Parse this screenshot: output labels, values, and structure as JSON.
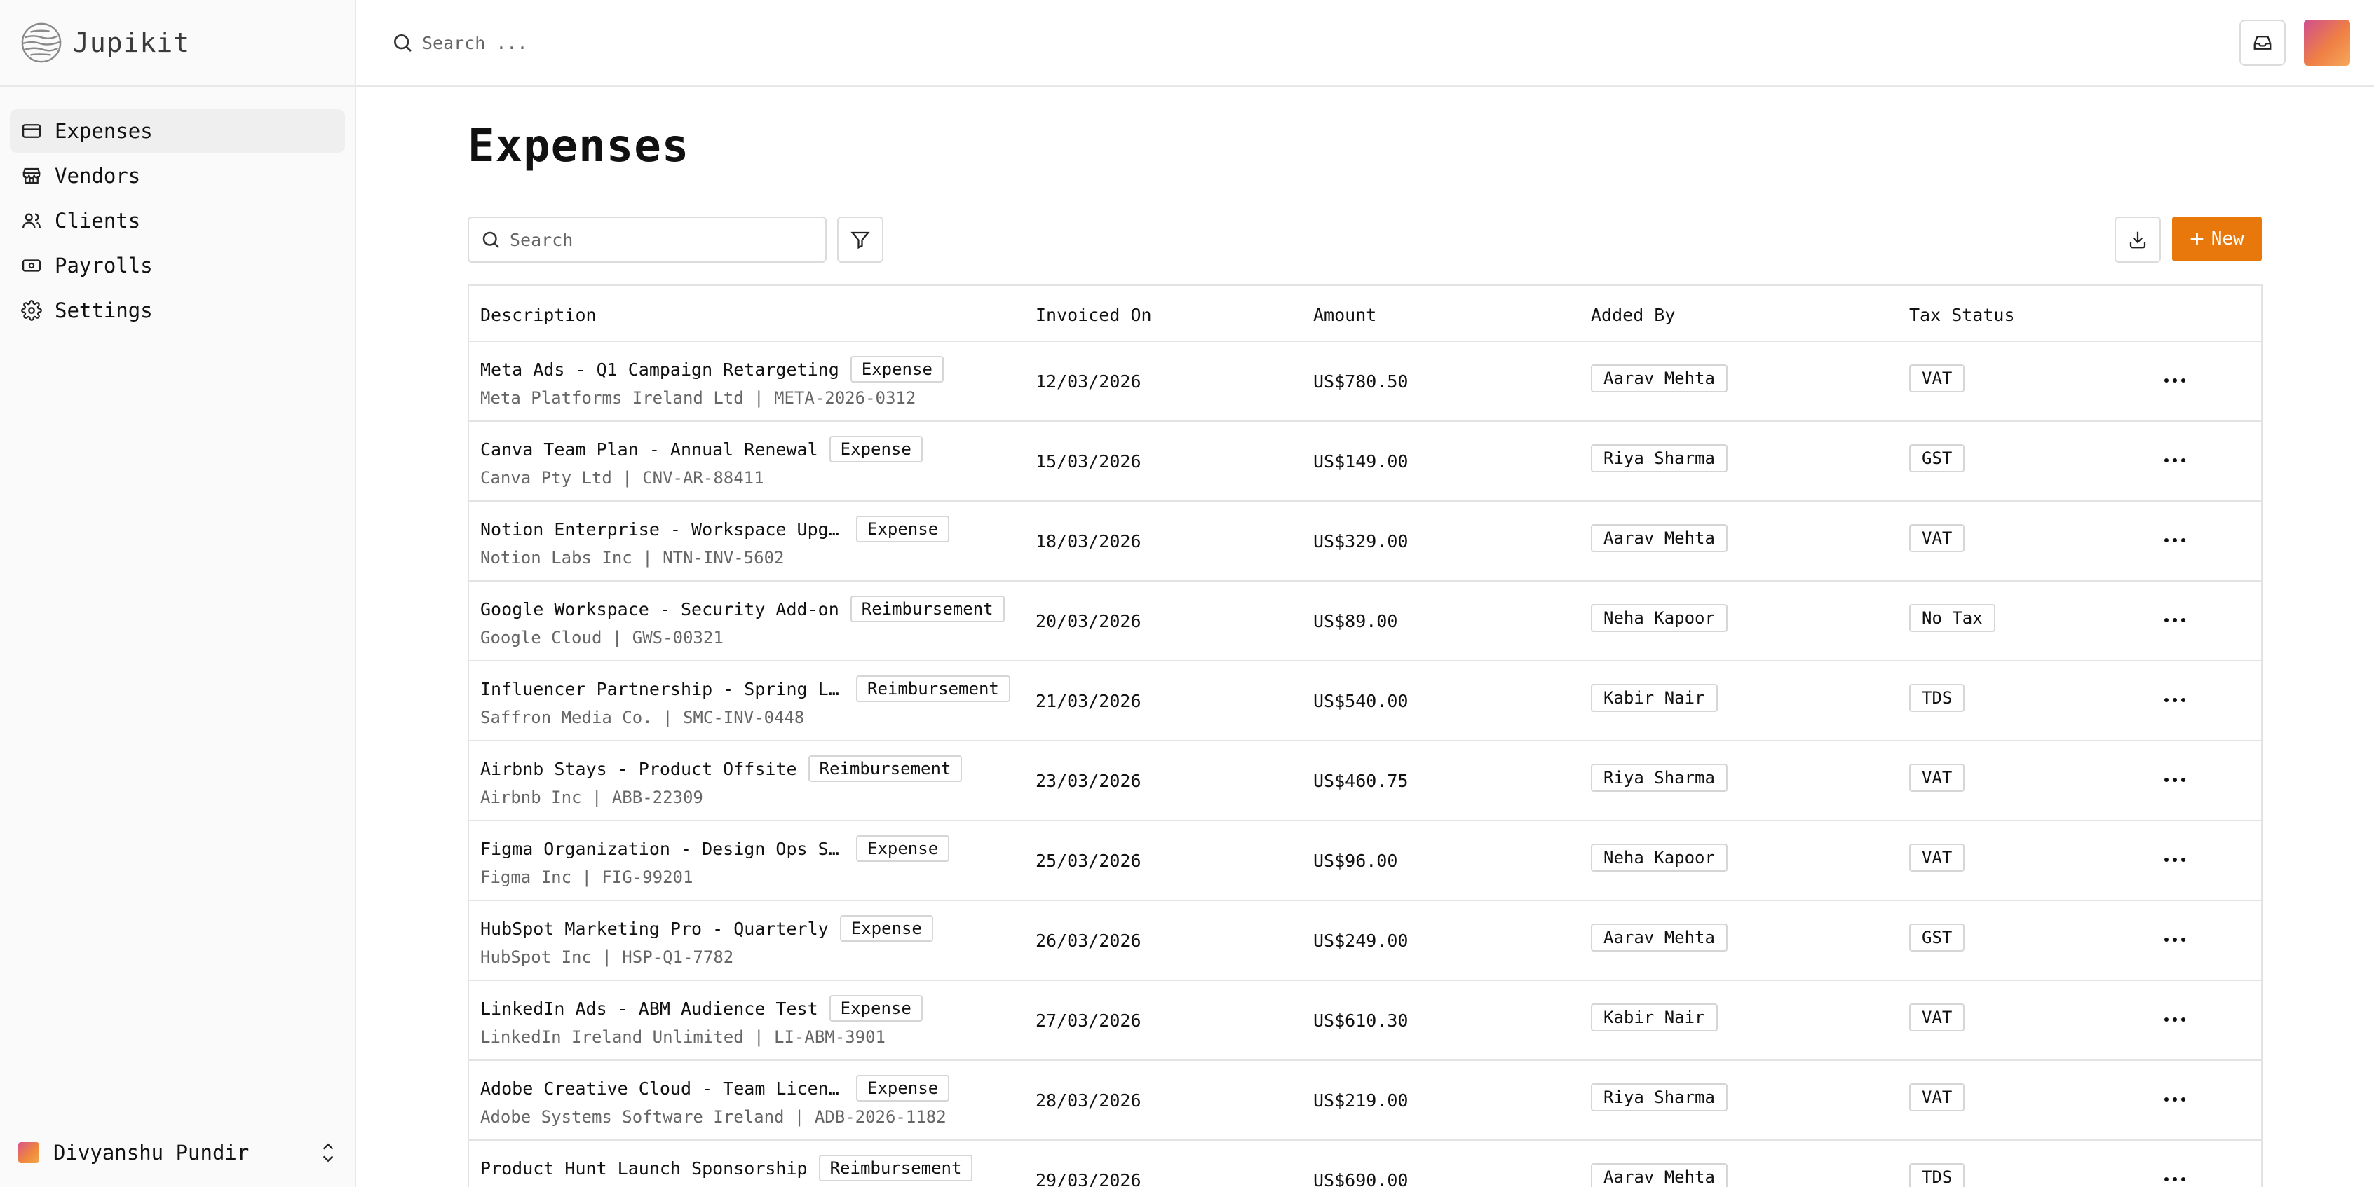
{
  "app": {
    "name": "Jupikit"
  },
  "sidebar": {
    "items": [
      {
        "label": "Expenses",
        "icon": "credit-card-icon",
        "active": true
      },
      {
        "label": "Vendors",
        "icon": "store-icon",
        "active": false
      },
      {
        "label": "Clients",
        "icon": "users-icon",
        "active": false
      },
      {
        "label": "Payrolls",
        "icon": "banknote-icon",
        "active": false
      },
      {
        "label": "Settings",
        "icon": "gear-icon",
        "active": false
      }
    ],
    "user": {
      "name": "Divyanshu Pundir"
    }
  },
  "topbar": {
    "search_placeholder": "Search ..."
  },
  "page": {
    "title": "Expenses",
    "search_placeholder": "Search",
    "new_label": "New"
  },
  "table": {
    "headers": [
      "Description",
      "Invoiced On",
      "Amount",
      "Added By",
      "Tax Status"
    ],
    "rows": [
      {
        "title": "Meta Ads - Q1 Campaign Retargeting",
        "tag": "Expense",
        "sub": "Meta Platforms Ireland Ltd | META-2026-0312",
        "date": "12/03/2026",
        "amount": "US$780.50",
        "by": "Aarav Mehta",
        "tax": "VAT"
      },
      {
        "title": "Canva Team Plan - Annual Renewal",
        "tag": "Expense",
        "sub": "Canva Pty Ltd | CNV-AR-88411",
        "date": "15/03/2026",
        "amount": "US$149.00",
        "by": "Riya Sharma",
        "tax": "GST"
      },
      {
        "title": "Notion Enterprise - Workspace Upgrade",
        "tag": "Expense",
        "sub": "Notion Labs Inc | NTN-INV-5602",
        "date": "18/03/2026",
        "amount": "US$329.00",
        "by": "Aarav Mehta",
        "tax": "VAT"
      },
      {
        "title": "Google Workspace - Security Add-on",
        "tag": "Reimbursement",
        "sub": "Google Cloud | GWS-00321",
        "date": "20/03/2026",
        "amount": "US$89.00",
        "by": "Neha Kapoor",
        "tax": "No Tax"
      },
      {
        "title": "Influencer Partnership - Spring Lau…",
        "tag": "Reimbursement",
        "sub": "Saffron Media Co. | SMC-INV-0448",
        "date": "21/03/2026",
        "amount": "US$540.00",
        "by": "Kabir Nair",
        "tax": "TDS"
      },
      {
        "title": "Airbnb Stays - Product Offsite",
        "tag": "Reimbursement",
        "sub": "Airbnb Inc | ABB-22309",
        "date": "23/03/2026",
        "amount": "US$460.75",
        "by": "Riya Sharma",
        "tax": "VAT"
      },
      {
        "title": "Figma Organization - Design Ops Seats",
        "tag": "Expense",
        "sub": "Figma Inc | FIG-99201",
        "date": "25/03/2026",
        "amount": "US$96.00",
        "by": "Neha Kapoor",
        "tax": "VAT"
      },
      {
        "title": "HubSpot Marketing Pro - Quarterly",
        "tag": "Expense",
        "sub": "HubSpot Inc | HSP-Q1-7782",
        "date": "26/03/2026",
        "amount": "US$249.00",
        "by": "Aarav Mehta",
        "tax": "GST"
      },
      {
        "title": "LinkedIn Ads - ABM Audience Test",
        "tag": "Expense",
        "sub": "LinkedIn Ireland Unlimited | LI-ABM-3901",
        "date": "27/03/2026",
        "amount": "US$610.30",
        "by": "Kabir Nair",
        "tax": "VAT"
      },
      {
        "title": "Adobe Creative Cloud - Team Licenses",
        "tag": "Expense",
        "sub": "Adobe Systems Software Ireland | ADB-2026-1182",
        "date": "28/03/2026",
        "amount": "US$219.00",
        "by": "Riya Sharma",
        "tax": "VAT"
      },
      {
        "title": "Product Hunt Launch Sponsorship",
        "tag": "Reimbursement",
        "sub": "",
        "date": "29/03/2026",
        "amount": "US$690.00",
        "by": "Aarav Mehta",
        "tax": "TDS"
      }
    ]
  },
  "colors": {
    "accent": "#e8780c",
    "border": "#e3e3e3",
    "muted_text": "#666666"
  }
}
